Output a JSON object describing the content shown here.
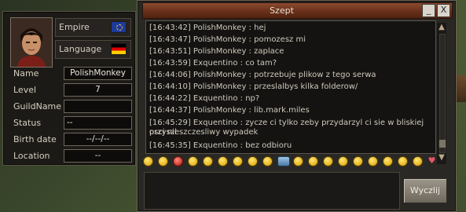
{
  "character": {
    "empire_label": "Empire",
    "language_label": "Language",
    "fields": [
      {
        "label": "Name",
        "value": "PolishMonkey"
      },
      {
        "label": "Level",
        "value": "7"
      },
      {
        "label": "GuildName",
        "value": ""
      },
      {
        "label": "Status",
        "value": "--"
      },
      {
        "label": "Birth date",
        "value": "--/--/--"
      },
      {
        "label": "Location",
        "value": "--"
      }
    ]
  },
  "chat": {
    "title": "Szept",
    "minimize_label": "_",
    "close_label": "X",
    "messages": [
      "[16:43:42] PolishMonkey : hej",
      "[16:43:47] PolishMonkey : pomozesz mi",
      "[16:43:51] PolishMonkey : zaplace",
      "[16:43:59] Exquentino : co tam?",
      "[16:44:06] PolishMonkey : potrzebuje plikow z tego serwa",
      "[16:44:10] PolishMonkey : przeslalbys kilka folderow/",
      "[16:44:22] Exquentino : np?",
      "[16:44:37] PolishMonkey : lib.mark.miles",
      "[16:45:29] Exquentino : zycze ci tylko zeby przydarzyl ci sie w bliskiej przyszl",
      "osci nieszczesliwy wypadek",
      "[16:45:35] Exquentino : bez odbioru"
    ],
    "input_value": "",
    "send_label": "Wyczlij"
  }
}
